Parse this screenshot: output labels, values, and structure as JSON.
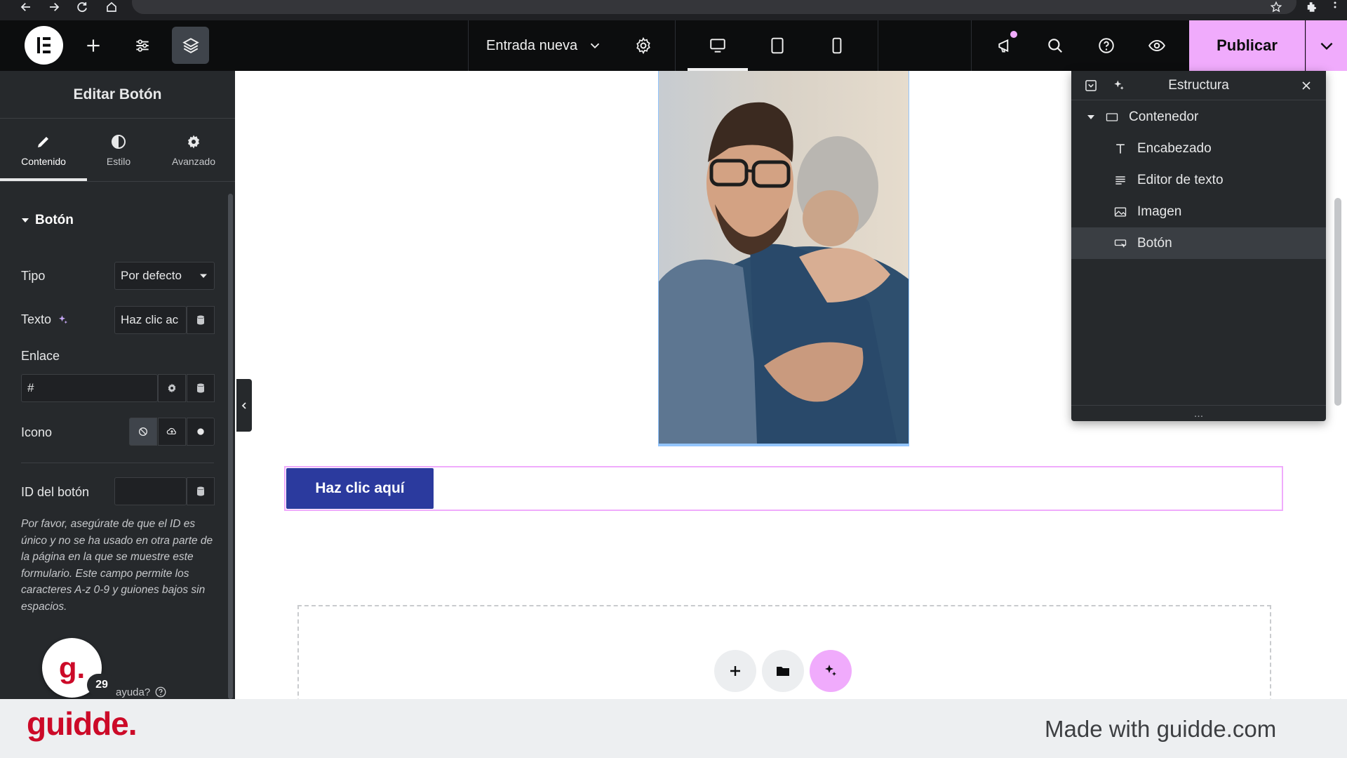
{
  "toolbar": {
    "document_title": "Entrada nueva",
    "publish_label": "Publicar",
    "colors": {
      "background": "#0c0d0e",
      "publish": "#f0abfc"
    },
    "icons": [
      "plus-icon",
      "sliders-icon",
      "layers-icon",
      "gear-icon",
      "desktop-icon",
      "tablet-icon",
      "mobile-icon",
      "megaphone-icon",
      "search-icon",
      "help-icon",
      "eye-icon",
      "chevron-down-icon"
    ]
  },
  "panel": {
    "title": "Editar Botón",
    "tabs": [
      {
        "label": "Contenido",
        "icon": "pencil-icon",
        "active": true
      },
      {
        "label": "Estilo",
        "icon": "contrast-icon",
        "active": false
      },
      {
        "label": "Avanzado",
        "icon": "gear-icon",
        "active": false
      }
    ],
    "section_title": "Botón",
    "tipo_label": "Tipo",
    "tipo_value": "Por defecto",
    "texto_label": "Texto",
    "texto_value": "Haz clic ac",
    "enlace_label": "Enlace",
    "enlace_value": "#",
    "icono_label": "Icono",
    "id_label": "ID del botón",
    "id_value": "",
    "help_text": "Por favor, asegúrate de que el ID es único y no se ha usado en otra parte de la página en la que se muestre este formulario. Este campo permite los caracteres A-z  0-9 y guiones bajos sin espacios.",
    "help_link": "ayuda?",
    "avatar_letter": "g.",
    "badge_count": "29"
  },
  "canvas": {
    "button_label": "Haz clic aquí",
    "button_color": "#2b3a9e",
    "selection_color": "#f0abfc"
  },
  "structure": {
    "title": "Estructura",
    "items": [
      {
        "label": "Contenedor",
        "icon": "container-icon"
      },
      {
        "label": "Encabezado",
        "icon": "heading-icon"
      },
      {
        "label": "Editor de texto",
        "icon": "text-editor-icon"
      },
      {
        "label": "Imagen",
        "icon": "image-icon"
      },
      {
        "label": "Botón",
        "icon": "button-icon",
        "selected": true
      }
    ],
    "more": "..."
  },
  "footer": {
    "brand": "guidde.",
    "made_with": "Made with guidde.com"
  }
}
